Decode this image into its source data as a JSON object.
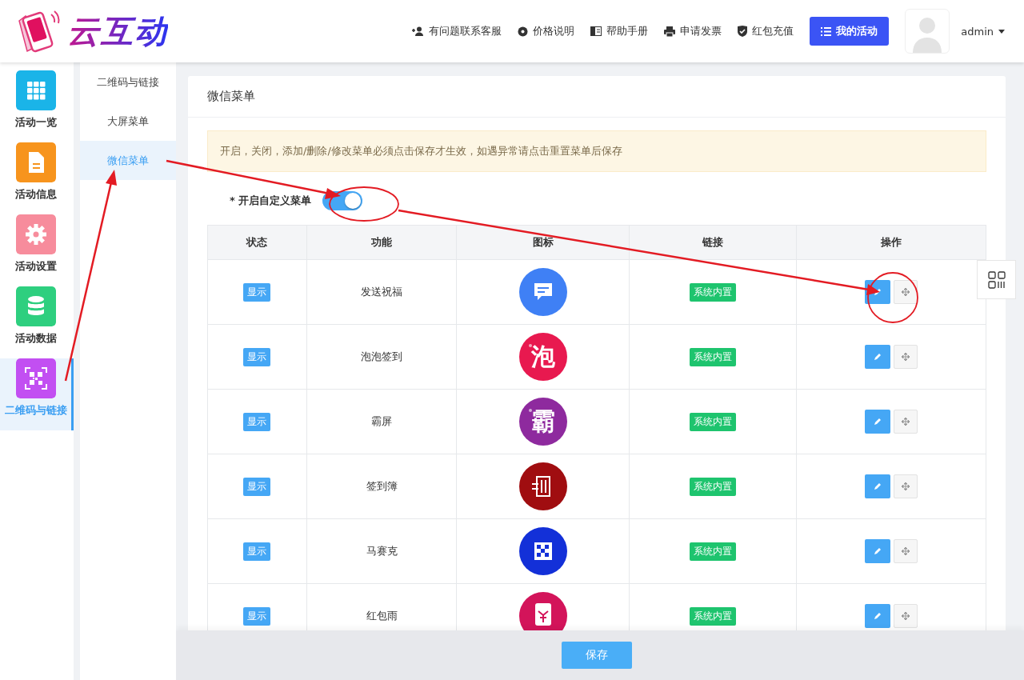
{
  "header": {
    "logo_text": "云互动",
    "links": [
      {
        "label": "有问题联系客服",
        "kind": "user-plus"
      },
      {
        "label": "价格说明",
        "kind": "badge"
      },
      {
        "label": "帮助手册",
        "kind": "book"
      },
      {
        "label": "申请发票",
        "kind": "printer"
      },
      {
        "label": "红包充值",
        "kind": "shield"
      }
    ],
    "primary_button": "我的活动",
    "user": "admin"
  },
  "sidebar": {
    "items": [
      {
        "label": "活动一览",
        "kind": "grid",
        "color": "#1ab4e8",
        "selected": false
      },
      {
        "label": "活动信息",
        "kind": "doc",
        "color": "#f7941d",
        "selected": false
      },
      {
        "label": "活动设置",
        "kind": "gear",
        "color": "#f78c9c",
        "selected": false
      },
      {
        "label": "活动数据",
        "kind": "database",
        "color": "#2ecf7f",
        "selected": false
      },
      {
        "label": "二维码与链接",
        "kind": "qr",
        "color": "#c24ff2",
        "selected": true
      }
    ]
  },
  "submenu": {
    "items": [
      {
        "label": "二维码与链接",
        "selected": false
      },
      {
        "label": "大屏菜单",
        "selected": false
      },
      {
        "label": "微信菜单",
        "selected": true
      }
    ]
  },
  "card": {
    "title": "微信菜单",
    "notice": "开启，关闭，添加/删除/修改菜单必须点击保存才生效，如遇异常请点击重置菜单后保存",
    "toggle": {
      "label": "* 开启自定义菜单",
      "on": true
    }
  },
  "table": {
    "columns": [
      "状态",
      "功能",
      "图标",
      "链接",
      "操作"
    ],
    "rows": [
      {
        "status": "显示",
        "function": "发送祝福",
        "kind": "chat",
        "color": "#3f80f5",
        "link": "系统内置"
      },
      {
        "status": "显示",
        "function": "泡泡签到",
        "kind": "glyph",
        "icon_text": "泡",
        "color": "#e8194f",
        "link": "系统内置"
      },
      {
        "status": "显示",
        "function": "霸屏",
        "kind": "glyph",
        "icon_text": "霸",
        "color": "#8e2a9e",
        "link": "系统内置"
      },
      {
        "status": "显示",
        "function": "签到簿",
        "kind": "sign",
        "color": "#a00d10",
        "link": "系统内置"
      },
      {
        "status": "显示",
        "function": "马赛克",
        "kind": "mosaic",
        "color": "#1330d8",
        "link": "系统内置"
      },
      {
        "status": "显示",
        "function": "红包雨",
        "kind": "packet",
        "color": "#d3145a",
        "link": "系统内置"
      }
    ]
  },
  "footer": {
    "save_button": "保存"
  }
}
